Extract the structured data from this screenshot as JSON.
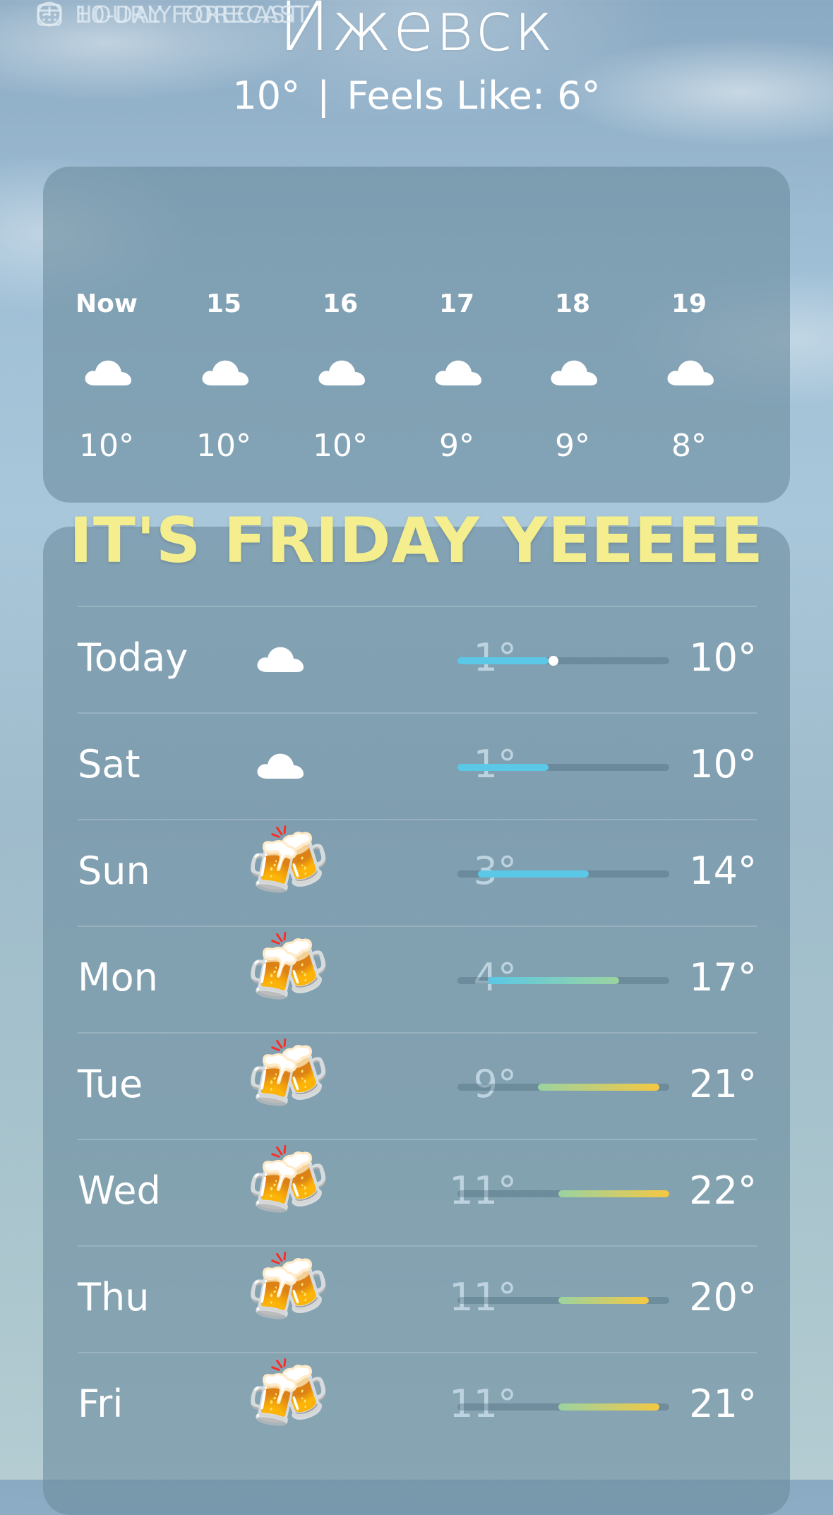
{
  "location": {
    "city": "Ижевск",
    "current_temp": "10°",
    "separator": "|",
    "feels_like": "Feels Like: 6°"
  },
  "hourly": {
    "title": "HOURLY FORECAST",
    "icon": "clock-icon",
    "items": [
      {
        "time": "Now",
        "temp": "10°",
        "icon": "cloud-icon"
      },
      {
        "time": "15",
        "temp": "10°",
        "icon": "cloud-icon"
      },
      {
        "time": "16",
        "temp": "10°",
        "icon": "cloud-icon"
      },
      {
        "time": "17",
        "temp": "9°",
        "icon": "cloud-icon"
      },
      {
        "time": "18",
        "temp": "9°",
        "icon": "cloud-icon"
      },
      {
        "time": "19",
        "temp": "8°",
        "icon": "cloud-icon"
      }
    ]
  },
  "overlay_text": "IT'S FRIDAY YEEEEE",
  "daily": {
    "title": "10-DAY FORECAST",
    "icon": "calendar-icon",
    "days": [
      {
        "day": "Today",
        "low": "1°",
        "high": "10°",
        "icon": "cloud-icon"
      },
      {
        "day": "Sat",
        "low": "1°",
        "high": "10°",
        "icon": "cloud-icon"
      },
      {
        "day": "Sun",
        "low": "3°",
        "high": "14°",
        "icon": "beer-mugs-emoji",
        "emoji": "🍻"
      },
      {
        "day": "Mon",
        "low": "4°",
        "high": "17°",
        "icon": "beer-mugs-emoji",
        "emoji": "🍻"
      },
      {
        "day": "Tue",
        "low": "9°",
        "high": "21°",
        "icon": "beer-mugs-emoji",
        "emoji": "🍻"
      },
      {
        "day": "Wed",
        "low": "11°",
        "high": "22°",
        "icon": "beer-mugs-emoji",
        "emoji": "🍻"
      },
      {
        "day": "Thu",
        "low": "11°",
        "high": "20°",
        "icon": "beer-mugs-emoji",
        "emoji": "🍻"
      },
      {
        "day": "Fri",
        "low": "11°",
        "high": "21°",
        "icon": "beer-mugs-emoji",
        "emoji": "🍻"
      }
    ]
  },
  "colors": {
    "cool": "#5ac8e6",
    "mild": "#9ad3a0",
    "warm": "#f5c842",
    "overlay": "#f4ee8f"
  }
}
